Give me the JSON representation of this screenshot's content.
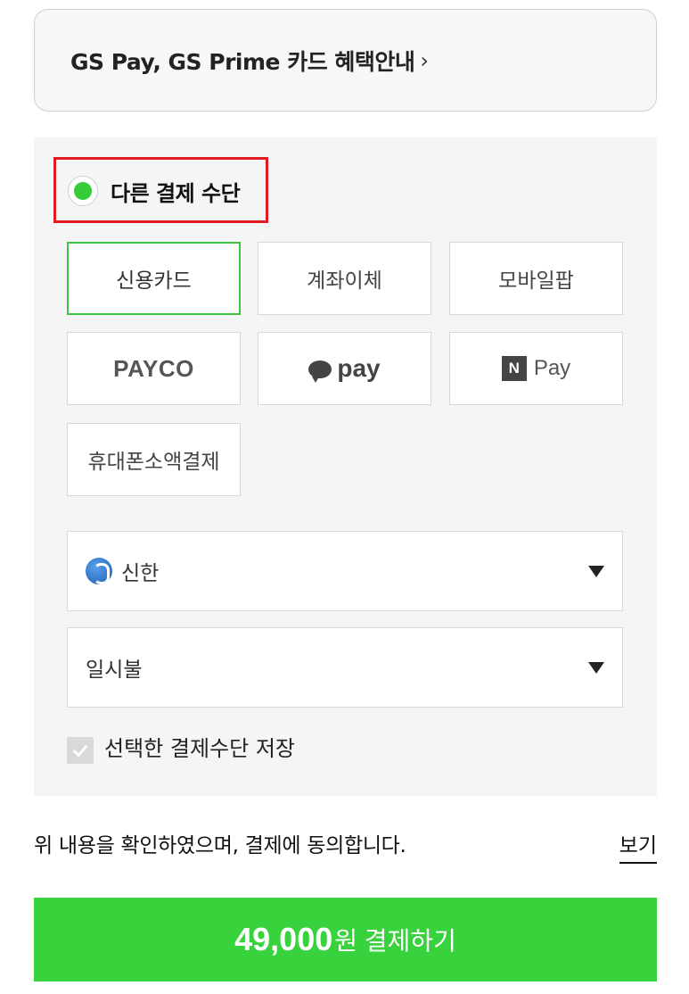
{
  "benefit": {
    "text": "GS Pay, GS Prime 카드 혜택안내",
    "chevron": "›"
  },
  "payment": {
    "other_method_label": "다른 결제 수단",
    "methods": [
      {
        "label": "신용카드",
        "selected": true
      },
      {
        "label": "계좌이체",
        "selected": false
      },
      {
        "label": "모바일팝",
        "selected": false
      },
      {
        "label": "PAYCO",
        "selected": false
      },
      {
        "label": "pay",
        "selected": false
      },
      {
        "label": "Pay",
        "logo_letter": "N",
        "selected": false
      },
      {
        "label": "휴대폰소액결제",
        "selected": false
      }
    ],
    "card_select": {
      "value": "신한",
      "icon": "shinhan-bank-icon"
    },
    "installment_select": {
      "value": "일시불"
    },
    "save_label": "선택한 결제수단 저장",
    "save_checked": true
  },
  "agreement": {
    "text": "위 내용을 확인하였으며, 결제에 동의합니다.",
    "view_label": "보기"
  },
  "pay_button": {
    "amount": "49,000",
    "text": "원 결제하기"
  },
  "colors": {
    "accent_green": "#38d23d",
    "selected_border": "#3dc341",
    "highlight_red": "#e11b22",
    "panel_bg": "#f5f5f5"
  }
}
